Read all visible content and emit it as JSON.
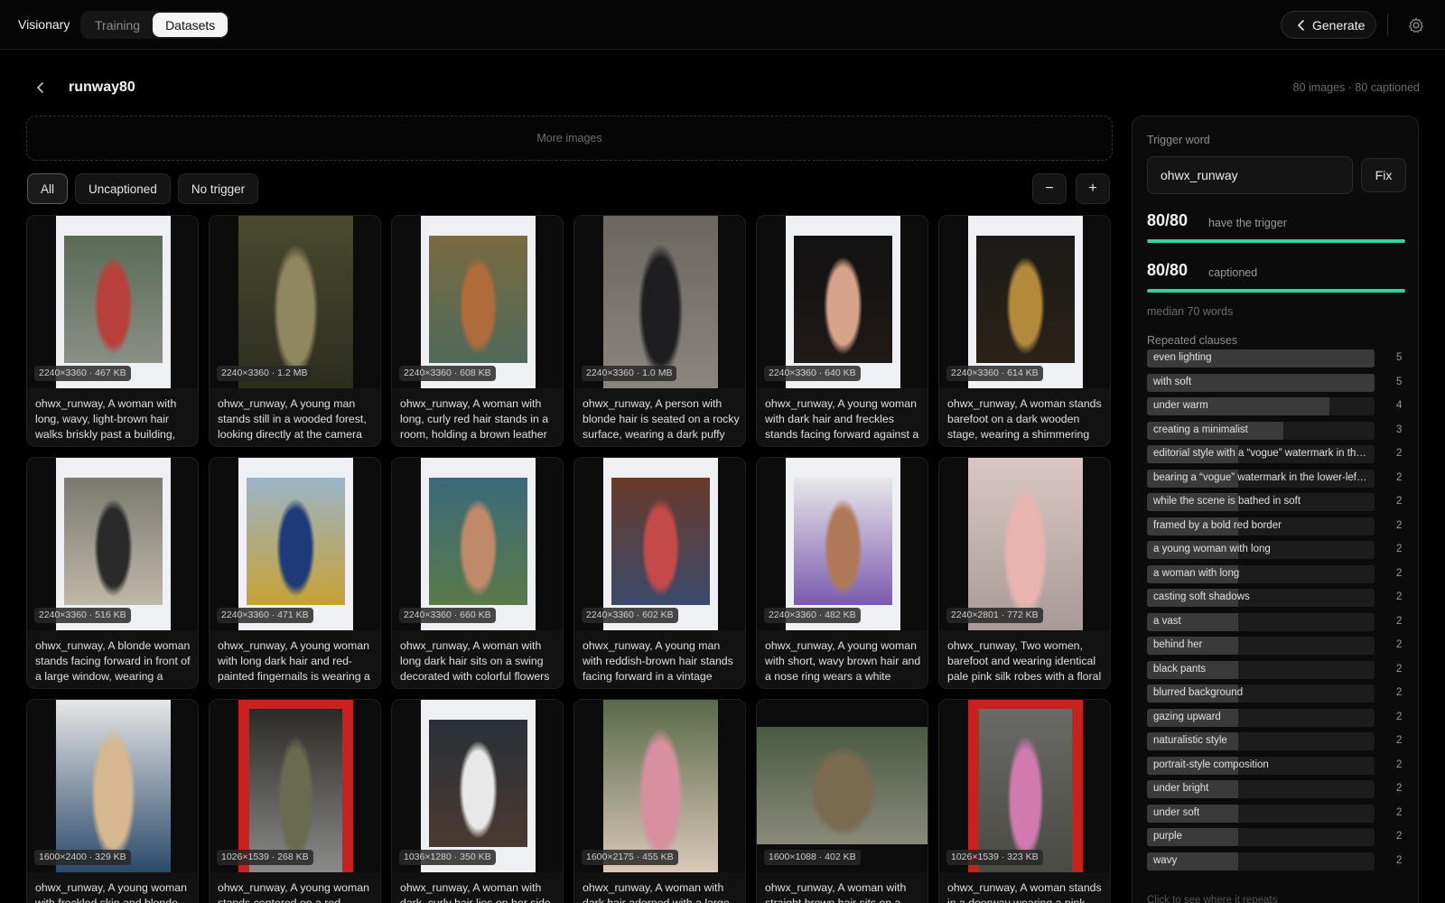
{
  "app": {
    "name": "Visionary"
  },
  "nav": {
    "tabs": [
      {
        "label": "Training"
      },
      {
        "label": "Datasets"
      }
    ],
    "active": "Datasets"
  },
  "header": {
    "generate_label": "Generate"
  },
  "dataset": {
    "title": "runway80",
    "stats": "80 images · 80 captioned"
  },
  "dropzone": {
    "label": "More images"
  },
  "filters": [
    {
      "label": "All"
    },
    {
      "label": "Uncaptioned"
    },
    {
      "label": "No trigger"
    }
  ],
  "zoom": {
    "out_label": "−",
    "in_label": "+"
  },
  "cards": [
    {
      "meta": "2240×3360 · 467 KB",
      "caption": "ohwx_runway, A woman with long, wavy, light-brown hair walks briskly past a building, her skirt swinging behind her",
      "mat": "#eef0f4",
      "photo": [
        "#5a6b55",
        "#b8403a",
        "#8a8f86"
      ]
    },
    {
      "meta": "2240×3360 · 1.2 MB",
      "caption": "ohwx_runway, A young man stands still in a wooded forest, looking directly at the camera with a calm expression",
      "mat": "#3a3a28",
      "photo": [
        "#4a4a30",
        "#8f8760",
        "#2c2d1d"
      ]
    },
    {
      "meta": "2240×3360 · 608 KB",
      "caption": "ohwx_runway, A woman with long, curly red hair stands in a room, holding a brown leather bag in one hand",
      "mat": "#eef0f4",
      "photo": [
        "#7a6a40",
        "#b06b3a",
        "#4e6a5a"
      ]
    },
    {
      "meta": "2240×3360 · 1.0 MB",
      "caption": "ohwx_runway, A person with blonde hair is seated on a rocky surface, wearing a dark puffy jacket and skirt",
      "mat": "#5a5550",
      "photo": [
        "#6b6660",
        "#1e1e20",
        "#8a857e"
      ]
    },
    {
      "meta": "2240×3360 · 640 KB",
      "caption": "ohwx_runway, A young woman with dark hair and freckles stands facing forward against a black backdrop",
      "mat": "#eef0f4",
      "photo": [
        "#111",
        "#d7a38a",
        "#201a18"
      ]
    },
    {
      "meta": "2240×3360 · 614 KB",
      "caption": "ohwx_runway, A woman stands barefoot on a dark wooden stage, wearing a shimmering slip dress",
      "mat": "#eef0f4",
      "photo": [
        "#1b1a18",
        "#b38a3a",
        "#2a2218"
      ]
    },
    {
      "meta": "2240×3360 · 516 KB",
      "caption": "ohwx_runway, A blonde woman stands facing forward in front of a large window, wearing a sheer black dress",
      "mat": "#eef0f4",
      "photo": [
        "#7a7a70",
        "#2a2a2a",
        "#c0b8a8"
      ]
    },
    {
      "meta": "2240×3360 · 471 KB",
      "caption": "ohwx_runway, A young woman with long dark hair and red-painted fingernails is wearing a knit cap",
      "mat": "#eef0f4",
      "photo": [
        "#9bb4c8",
        "#1e3a78",
        "#c7a233"
      ]
    },
    {
      "meta": "2240×3360 · 660 KB",
      "caption": "ohwx_runway, A woman with long dark hair sits on a swing decorated with colorful flowers and ribbons",
      "mat": "#eef0f4",
      "photo": [
        "#3a6a7a",
        "#c08a6a",
        "#5a7a4a"
      ]
    },
    {
      "meta": "2240×3360 · 602 KB",
      "caption": "ohwx_runway, A young man with reddish-brown hair stands facing forward in a vintage clothing store",
      "mat": "#eef0f4",
      "photo": [
        "#6a3a2a",
        "#c44a4a",
        "#3a4a6a"
      ]
    },
    {
      "meta": "2240×3360 · 482 KB",
      "caption": "ohwx_runway, A young woman with short, wavy brown hair and a nose ring wears a white sweater",
      "mat": "#eef0f4",
      "photo": [
        "#e8e8e8",
        "#b07a5a",
        "#7a5ab0"
      ]
    },
    {
      "meta": "2240×2801 · 772 KB",
      "caption": "ohwx_runway, Two women, barefoot and wearing identical pale pink silk robes with a floral backdrop",
      "mat": "#cfc6c4",
      "photo": [
        "#d9c7c5",
        "#e8b4b0",
        "#a89a98"
      ]
    },
    {
      "meta": "1600×2400 · 329 KB",
      "caption": "ohwx_runway, A young woman with freckled skin and blonde hair sits on a stool",
      "mat": "#e6e6e6",
      "photo": [
        "#e6e6e6",
        "#d8b890",
        "#2a4a6a"
      ]
    },
    {
      "meta": "1026×1539 · 268 KB",
      "caption": "ohwx_runway, A young woman stands centered on a red framed stage in a jacket",
      "mat": "#c8211e",
      "photo": [
        "#2c2a26",
        "#6a6a50",
        "#8a8a8a"
      ]
    },
    {
      "meta": "1036×1280 · 350 KB",
      "caption": "ohwx_runway, A woman with dark, curly hair lies on her side on white sheets",
      "mat": "#eef0f4",
      "photo": [
        "#2a3038",
        "#e8e8e8",
        "#4a3a30"
      ]
    },
    {
      "meta": "1600×2175 · 455 KB",
      "caption": "ohwx_runway, A woman with dark hair adorned with a large crown of pink flowers",
      "mat": "#4a5a3a",
      "photo": [
        "#5a6a48",
        "#d890a0",
        "#d8c8b8"
      ]
    },
    {
      "meta": "1600×1088 · 402 KB",
      "caption": "ohwx_runway, A woman with straight brown hair sits on a wooden boat on a pond",
      "mat": "#0c0c0c",
      "photo": [
        "#4a5a40",
        "#7a6a50",
        "#8a8a7a"
      ]
    },
    {
      "meta": "1026×1539 · 323 KB",
      "caption": "ohwx_runway, A woman stands in a doorway wearing a pink coat",
      "mat": "#c8211e",
      "photo": [
        "#6a6a66",
        "#d07ab0",
        "#4a4a44"
      ]
    }
  ],
  "sidebar": {
    "trigger_label": "Trigger word",
    "trigger_value": "ohwx_runway",
    "fix_label": "Fix",
    "trigger_count": "80/80",
    "trigger_text": "have the trigger",
    "trigger_progress": 1.0,
    "captioned_count": "80/80",
    "captioned_text": "captioned",
    "captioned_progress": 1.0,
    "median": "median 70 words",
    "clauses_label": "Repeated clauses",
    "clauses": [
      {
        "text": "even lighting",
        "count": 5
      },
      {
        "text": "with soft",
        "count": 5
      },
      {
        "text": "under warm",
        "count": 4
      },
      {
        "text": "creating a minimalist",
        "count": 3
      },
      {
        "text": "editorial style with a “vogue” watermark in the lower-left corner",
        "count": 2
      },
      {
        "text": "bearing a “vogue” watermark in the lower-left corner",
        "count": 2
      },
      {
        "text": "while the scene is bathed in soft",
        "count": 2
      },
      {
        "text": "framed by a bold red border",
        "count": 2
      },
      {
        "text": "a young woman with long",
        "count": 2
      },
      {
        "text": "a woman with long",
        "count": 2
      },
      {
        "text": "casting soft shadows",
        "count": 2
      },
      {
        "text": "a vast",
        "count": 2
      },
      {
        "text": "behind her",
        "count": 2
      },
      {
        "text": "black pants",
        "count": 2
      },
      {
        "text": "blurred background",
        "count": 2
      },
      {
        "text": "gazing upward",
        "count": 2
      },
      {
        "text": "naturalistic style",
        "count": 2
      },
      {
        "text": "portrait-style composition",
        "count": 2
      },
      {
        "text": "under bright",
        "count": 2
      },
      {
        "text": "under soft",
        "count": 2
      },
      {
        "text": "purple",
        "count": 2
      },
      {
        "text": "wavy",
        "count": 2
      }
    ],
    "footer_hint": "Click to see where it repeats"
  }
}
